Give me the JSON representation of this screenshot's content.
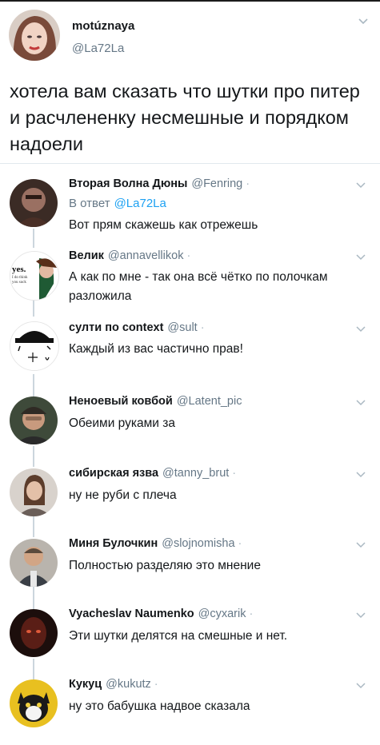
{
  "main_tweet": {
    "name": "motúznaya",
    "handle": "@La72La",
    "text": "хотела вам сказать что шутки про питер и расчлененку несмешные и порядком надоели"
  },
  "replies": [
    {
      "name": "Вторая Волна Дюны",
      "handle": "@Fenring",
      "reply_to_label": "В ответ",
      "reply_to": "@La72La",
      "text": "Вот прям скажешь как отрежешь"
    },
    {
      "name": "Велик",
      "handle": "@annavellikok",
      "avatar_text": "yes.",
      "avatar_small_text": "I do think you suck",
      "text": "А как по мне - так она всё чётко по полочкам разложила"
    },
    {
      "name": "султи по context",
      "handle": "@sult",
      "text": "Каждый из вас частично прав!"
    },
    {
      "name": "Неноевый ковбой",
      "handle": "@Latent_pic",
      "text": "Обеими руками за"
    },
    {
      "name": "сибирская язва",
      "handle": "@tanny_brut",
      "text": "ну не руби с плеча"
    },
    {
      "name": "Миня Булочкин",
      "handle": "@slojnomisha",
      "text": "Полностью разделяю это мнение"
    },
    {
      "name": "Vyacheslav Naumenko",
      "handle": "@cyxarik",
      "text": "Эти шутки делятся на смешные и нет."
    },
    {
      "name": "Кукуц",
      "handle": "@kukutz",
      "text": "ну это бабушка надвое сказала"
    }
  ],
  "colors": {
    "text": "#14171a",
    "muted": "#657786",
    "link": "#1da1f2",
    "line": "#ccd6dd"
  }
}
